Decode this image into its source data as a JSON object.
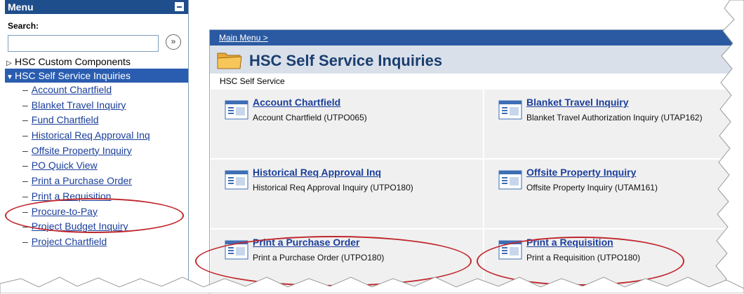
{
  "menu": {
    "title": "Menu",
    "search_label": "Search:",
    "search_value": "",
    "search_go_glyph": "»",
    "top_items": [
      {
        "label": "HSC Custom Components",
        "expanded": false
      },
      {
        "label": "HSC Self Service Inquiries",
        "expanded": true
      }
    ],
    "sub_items": [
      "Account Chartfield",
      "Blanket Travel Inquiry",
      "Fund Chartfield",
      "Historical Req Approval Inq",
      "Offsite Property Inquiry",
      "PO Quick View",
      "Print a Purchase Order",
      "Print a Requisition",
      "Procure-to-Pay",
      "Project Budget Inquiry",
      "Project Chartfield"
    ]
  },
  "main": {
    "breadcrumb": "Main Menu >",
    "title": "HSC Self Service Inquiries",
    "subheading": "HSC Self Service",
    "tiles": [
      {
        "title": "Account Chartfield",
        "desc": "Account Chartfield (UTPO065)"
      },
      {
        "title": "Blanket Travel Inquiry",
        "desc": "Blanket Travel Authorization Inquiry (UTAP162)"
      },
      {
        "title": "Historical Req Approval Inq",
        "desc": "Historical Req Approval Inquiry (UTPO180)"
      },
      {
        "title": "Offsite Property Inquiry",
        "desc": "Offsite Property Inquiry (UTAM161)"
      },
      {
        "title": "Print a Purchase Order",
        "desc": "Print a Purchase Order (UTPO180)"
      },
      {
        "title": "Print a Requisition",
        "desc": "Print a Requisition (UTPO180)"
      }
    ]
  },
  "colors": {
    "menu_header": "#1f4e8c",
    "selected_item": "#2a5db0",
    "link": "#1a3e9a",
    "annotation": "#c0272d"
  }
}
